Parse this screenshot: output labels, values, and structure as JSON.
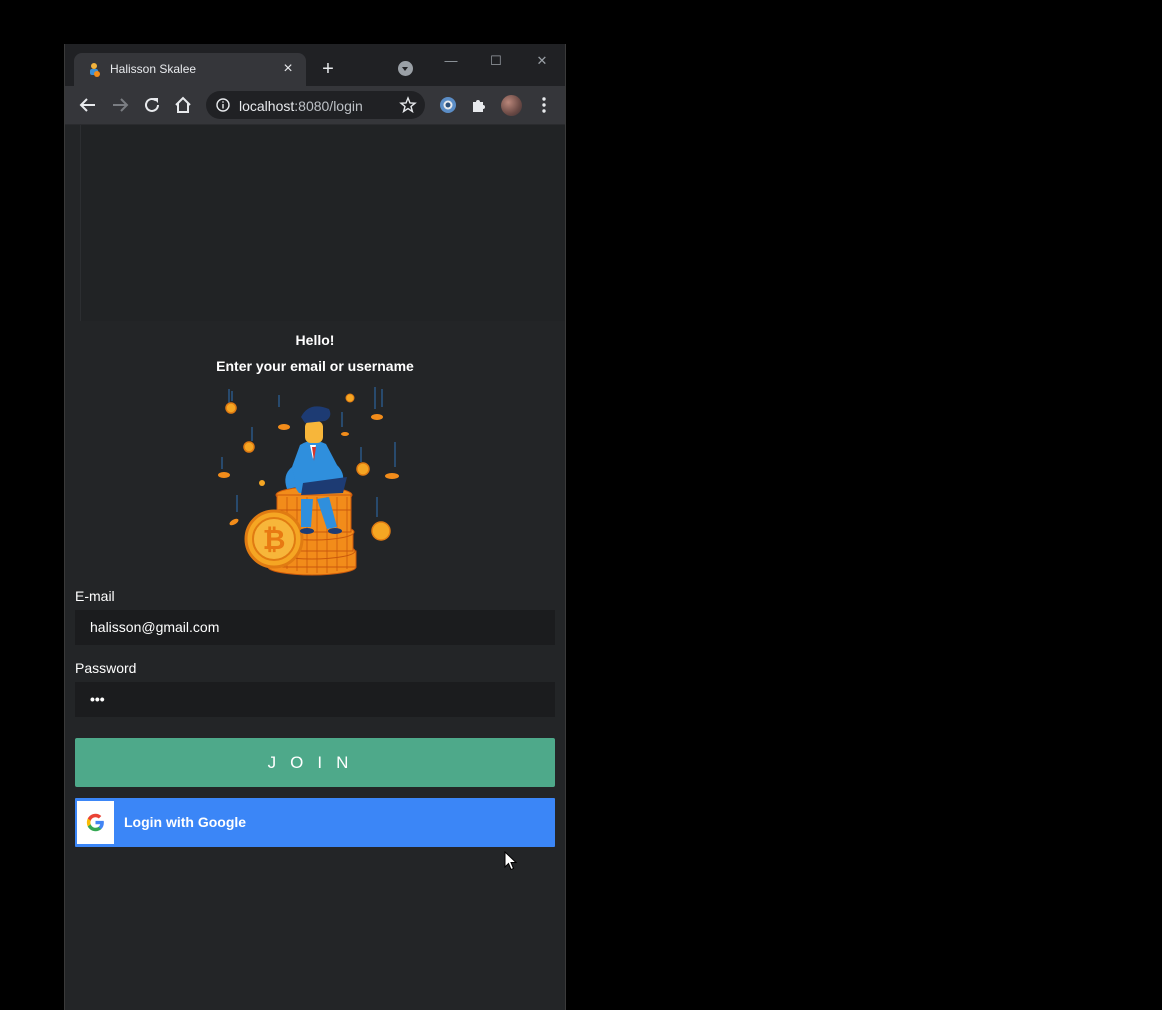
{
  "browser": {
    "tab_title": "Halisson Skalee",
    "tab_close": "×",
    "new_tab": "+",
    "url_host": "localhost",
    "url_path": ":8080/login"
  },
  "window_controls": {
    "minimize": "—",
    "maximize": "☐",
    "close": "✕"
  },
  "login": {
    "greeting": "Hello!",
    "instruction": "Enter your email or username",
    "email_label": "E-mail",
    "email_value": "halisson@gmail.com",
    "password_label": "Password",
    "password_value": "•••",
    "join_label": "JOIN",
    "google_label": "Login with Google"
  },
  "colors": {
    "join_button": "#4ea98a",
    "google_button": "#3b86f7",
    "page_background": "#232527"
  },
  "icons": [
    "back-icon",
    "forward-icon",
    "reload-icon",
    "home-icon",
    "info-icon",
    "star-icon",
    "extension-icon",
    "puzzle-icon",
    "avatar",
    "menu-icon",
    "google-logo-icon"
  ]
}
